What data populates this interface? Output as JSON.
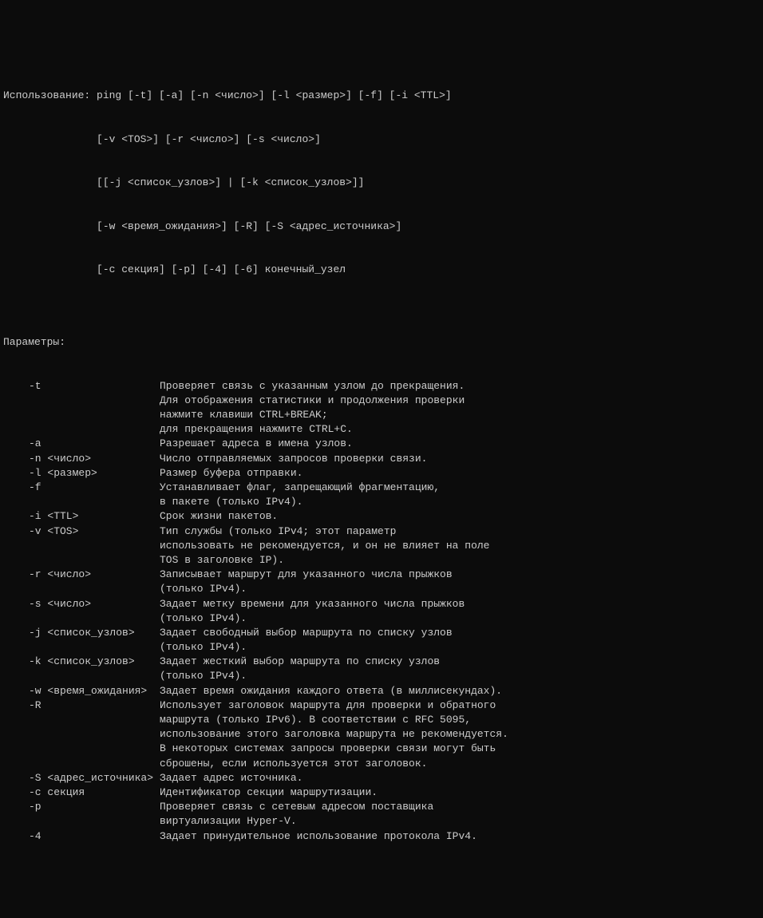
{
  "usage": {
    "label": "Использование:",
    "lines": [
      "Использование: ping [-t] [-a] [-n <число>] [-l <размер>] [-f] [-i <TTL>]",
      "               [-v <TOS>] [-r <число>] [-s <число>]",
      "               [[-j <список_узлов>] | [-k <список_узлов>]]",
      "               [-w <время_ожидания>] [-R] [-S <адрес_источника>]",
      "               [-c секция] [-p] [-4] [-6] конечный_узел"
    ]
  },
  "params_header": "Параметры:",
  "params": [
    {
      "flag": "-t",
      "desc": [
        "Проверяет связь с указанным узлом до прекращения.",
        "Для отображения статистики и продолжения проверки",
        "нажмите клавиши CTRL+BREAK;",
        "для прекращения нажмите CTRL+C."
      ]
    },
    {
      "flag": "-a",
      "desc": [
        "Разрешает адреса в имена узлов."
      ]
    },
    {
      "flag": "-n <число>",
      "desc": [
        "Число отправляемых запросов проверки связи."
      ]
    },
    {
      "flag": "-l <размер>",
      "desc": [
        "Размер буфера отправки."
      ]
    },
    {
      "flag": "-f",
      "desc": [
        "Устанавливает флаг, запрещающий фрагментацию,",
        "в пакете (только IPv4)."
      ]
    },
    {
      "flag": "-i <TTL>",
      "desc": [
        "Срок жизни пакетов."
      ]
    },
    {
      "flag": "-v <TOS>",
      "desc": [
        "Тип службы (только IPv4; этот параметр",
        "использовать не рекомендуется, и он не влияет на поле",
        "TOS в заголовке IP)."
      ]
    },
    {
      "flag": "-r <число>",
      "desc": [
        "Записывает маршрут для указанного числа прыжков",
        "(только IPv4)."
      ]
    },
    {
      "flag": "-s <число>",
      "desc": [
        "Задает метку времени для указанного числа прыжков",
        "(только IPv4)."
      ]
    },
    {
      "flag": "-j <список_узлов>",
      "desc": [
        "Задает свободный выбор маршрута по списку узлов",
        "(только IPv4)."
      ]
    },
    {
      "flag": "-k <список_узлов>",
      "desc": [
        "Задает жесткий выбор маршрута по списку узлов",
        "(только IPv4)."
      ]
    },
    {
      "flag": "-w <время_ожидания>",
      "desc": [
        "Задает время ожидания каждого ответа (в миллисекундах)."
      ]
    },
    {
      "flag": "-R",
      "desc": [
        "Использует заголовок маршрута для проверки и обратного",
        "маршрута (только IPv6). В соответствии с RFC 5095,",
        "использование этого заголовка маршрута не рекомендуется.",
        "В некоторых системах запросы проверки связи могут быть",
        "сброшены, если используется этот заголовок."
      ]
    },
    {
      "flag": "-S <адрес_источника>",
      "desc": [
        "Задает адрес источника."
      ]
    },
    {
      "flag": "-c секция",
      "desc": [
        "Идентификатор секции маршрутизации."
      ]
    },
    {
      "flag": "-p",
      "desc": [
        "Проверяет связь с сетевым адресом поставщика",
        "виртуализации Hyper-V."
      ]
    },
    {
      "flag": "-4",
      "desc": [
        "Задает принудительное использование протокола IPv4."
      ]
    }
  ]
}
